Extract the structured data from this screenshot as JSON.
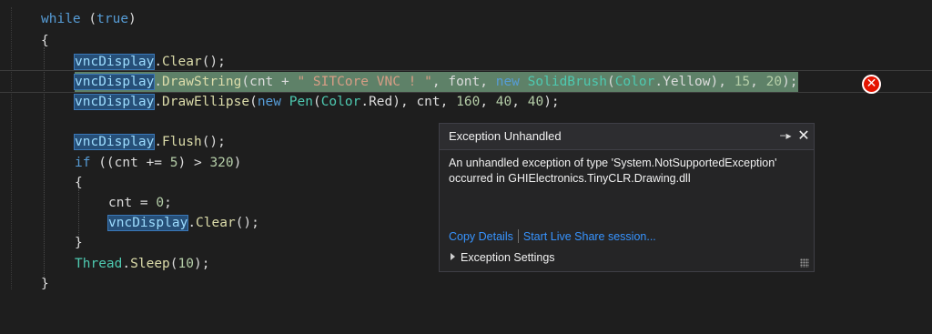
{
  "code": {
    "line1": {
      "kw": "while",
      "p1": " (",
      "val": "true",
      "p2": ")"
    },
    "line2": {
      "text": "{"
    },
    "line3": {
      "ref": "vncDisplay",
      "dot": ".",
      "method": "Clear",
      "rest": "();"
    },
    "line4": {
      "ref": "vncDisplay",
      "dot": ".",
      "method": "DrawString",
      "p1": "(cnt + ",
      "str": "\" SITCore VNC ! \"",
      "p2": ", font, ",
      "kw": "new",
      "sp": " ",
      "type1": "SolidBrush",
      "p3": "(",
      "type2": "Color",
      "p4": ".Yellow), ",
      "n1": "15",
      "p5": ", ",
      "n2": "20",
      "p6": ");"
    },
    "line5": {
      "ref": "vncDisplay",
      "dot": ".",
      "method": "DrawEllipse",
      "p1": "(",
      "kw": "new",
      "sp": " ",
      "type1": "Pen",
      "p2": "(",
      "type2": "Color",
      "p3": ".Red), cnt, ",
      "n1": "160",
      "p4": ", ",
      "n2": "40",
      "p5": ", ",
      "n3": "40",
      "p6": ");"
    },
    "line6": {
      "ref": "vncDisplay",
      "dot": ".",
      "method": "Flush",
      "rest": "();"
    },
    "line7": {
      "kw": "if",
      "p1": " ((cnt += ",
      "n1": "5",
      "p2": ") > ",
      "n2": "320",
      "p3": ")"
    },
    "line8": {
      "text": "{"
    },
    "line9": {
      "p1": "cnt = ",
      "n1": "0",
      "p2": ";"
    },
    "line10": {
      "ref": "vncDisplay",
      "dot": ".",
      "method": "Clear",
      "rest": "();"
    },
    "line11": {
      "text": "}"
    },
    "line12": {
      "type": "Thread",
      "dot": ".",
      "method": "Sleep",
      "p1": "(",
      "n1": "10",
      "p2": ");"
    },
    "line13": {
      "text": "}"
    }
  },
  "exception_popup": {
    "title": "Exception Unhandled",
    "message_line1": "An unhandled exception of type 'System.NotSupportedException'",
    "message_line2": "occurred in GHIElectronics.TinyCLR.Drawing.dll",
    "link_copy_details": "Copy Details",
    "link_live_share": "Start Live Share session...",
    "exception_settings_label": "Exception Settings",
    "pin_icon": "pin-icon",
    "close_icon": "close-icon",
    "error_icon": "error-icon"
  },
  "colors": {
    "background": "#1e1e1e",
    "keyword": "#569cd6",
    "type": "#4ec9b0",
    "method": "#dcdcaa",
    "string": "#d69d85",
    "number": "#b5cea8",
    "statement_highlight": "#5e8168",
    "error": "#e51400",
    "link": "#3794ff"
  }
}
